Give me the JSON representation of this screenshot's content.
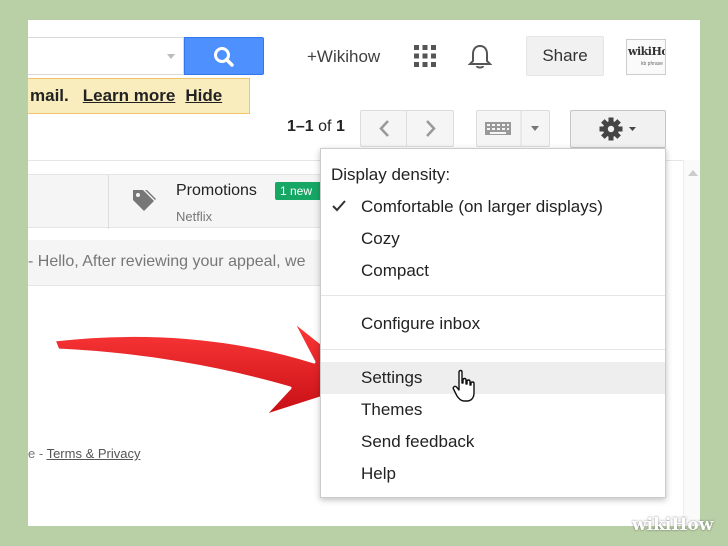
{
  "header": {
    "account_name": "+Wikihow",
    "share_label": "Share",
    "avatar_text_main": "wikiHow",
    "avatar_text_sub": "kb phrase"
  },
  "notice": {
    "text": "mail.",
    "learn_more": "Learn more",
    "hide": "Hide"
  },
  "pager": {
    "range": "1–1",
    "of": "of",
    "total": "1"
  },
  "tabs": {
    "promotions_title": "Promotions",
    "promotions_badge": "1 new",
    "promotions_sender": "Netflix"
  },
  "mail": {
    "snippet": "- Hello, After reviewing your appeal, we"
  },
  "footer": {
    "prefix": "e - ",
    "terms": "Terms & Privacy"
  },
  "menu": {
    "heading": "Display density:",
    "density_options": [
      {
        "label": "Comfortable (on larger displays)",
        "checked": true
      },
      {
        "label": "Cozy",
        "checked": false
      },
      {
        "label": "Compact",
        "checked": false
      }
    ],
    "configure_inbox": "Configure inbox",
    "settings": "Settings",
    "themes": "Themes",
    "send_feedback": "Send feedback",
    "help": "Help"
  },
  "watermark": {
    "text_a": "wiki",
    "text_b": "How"
  },
  "colors": {
    "search_blue": "#4d90fe",
    "notice_bg": "#f9edbe",
    "badge_green": "#16a765",
    "arrow_red": "#e8141b",
    "frame_green": "#b9cfa6"
  },
  "icons": [
    "search-icon",
    "apps-grid-icon",
    "bell-icon",
    "chevron-left-icon",
    "chevron-right-icon",
    "keyboard-icon",
    "gear-icon",
    "tag-icon",
    "check-icon",
    "hand-cursor-icon"
  ]
}
